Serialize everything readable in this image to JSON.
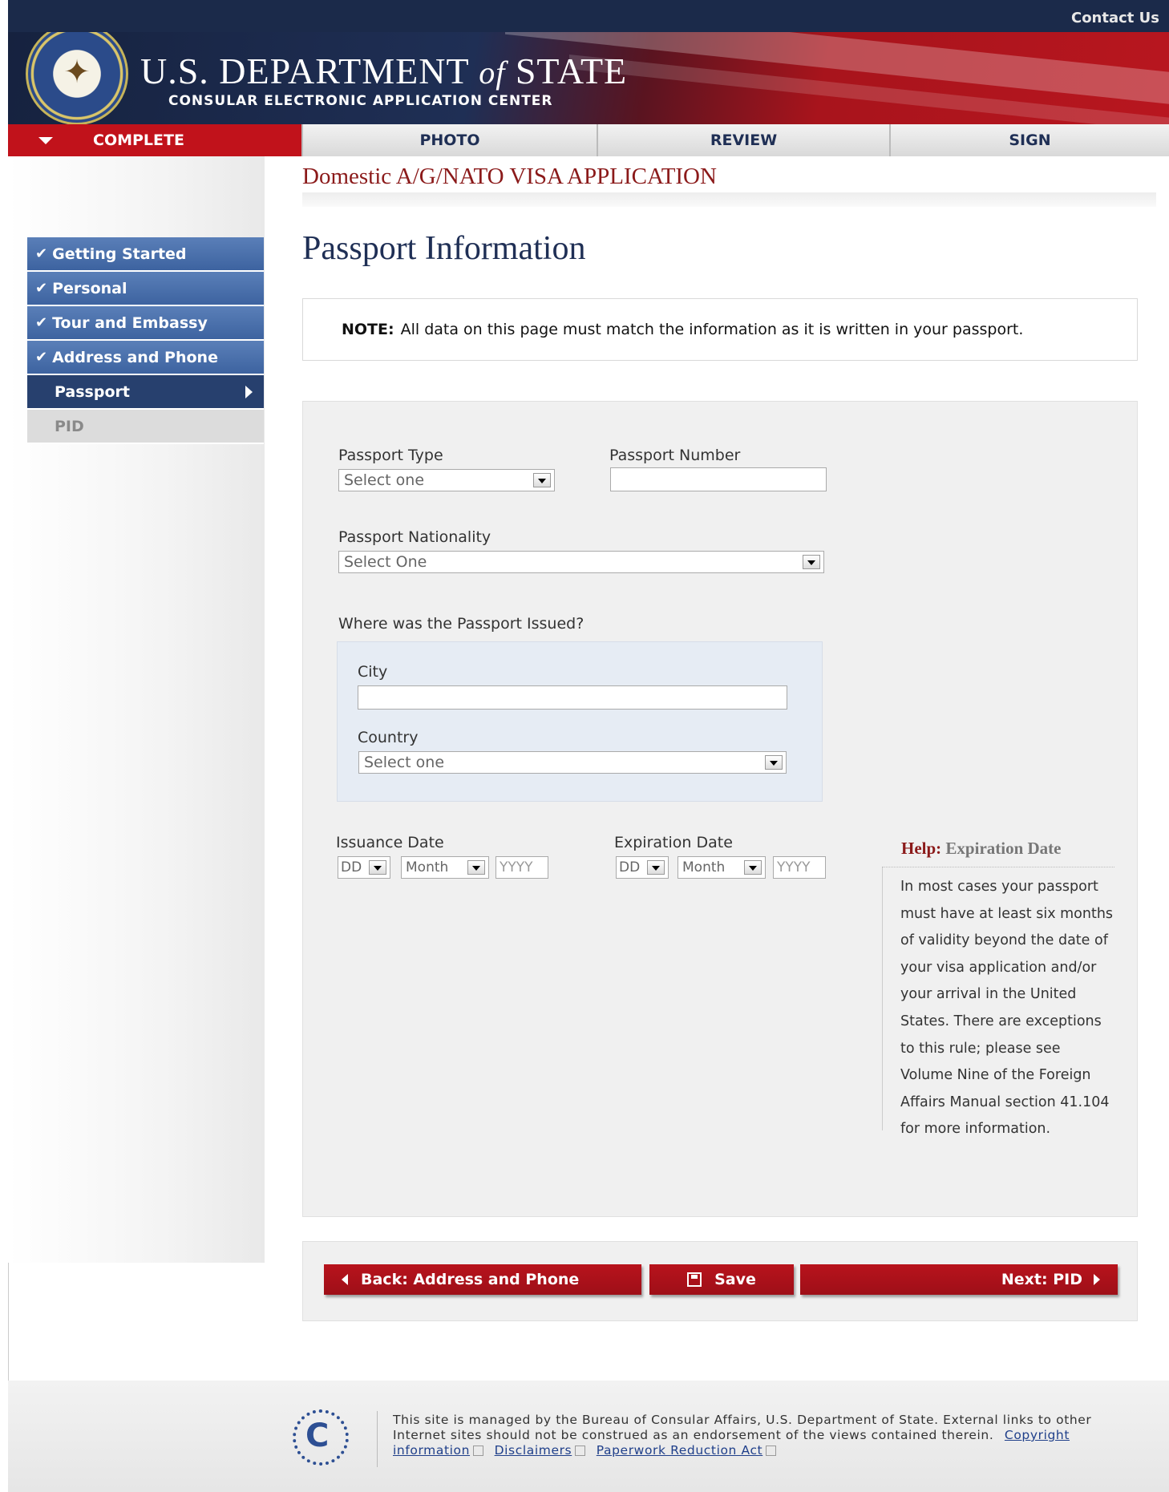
{
  "header": {
    "contact_label": "Contact Us",
    "dept_main": "U.S. DEPARTMENT",
    "dept_of": "of",
    "dept_state": "STATE",
    "subtitle": "CONSULAR ELECTRONIC APPLICATION CENTER"
  },
  "tabs": [
    {
      "label": "COMPLETE",
      "active": true
    },
    {
      "label": "PHOTO",
      "active": false
    },
    {
      "label": "REVIEW",
      "active": false
    },
    {
      "label": "SIGN",
      "active": false
    }
  ],
  "sidebar": {
    "items": [
      {
        "label": "Getting Started",
        "state": "done"
      },
      {
        "label": "Personal",
        "state": "done"
      },
      {
        "label": "Tour and Embassy",
        "state": "done"
      },
      {
        "label": "Address and Phone",
        "state": "done"
      },
      {
        "label": "Passport",
        "state": "current"
      },
      {
        "label": "PID",
        "state": "disabled"
      }
    ]
  },
  "main": {
    "app_title": "Domestic A/G/NATO VISA APPLICATION",
    "page_title": "Passport Information",
    "note_bold": "NOTE:",
    "note_text": "All data on this page must match the information as it is written in your passport."
  },
  "form": {
    "passport_type": {
      "label": "Passport Type",
      "value": "Select one"
    },
    "passport_number": {
      "label": "Passport Number",
      "value": ""
    },
    "passport_nationality": {
      "label": "Passport Nationality",
      "value": "Select One"
    },
    "issued_question": "Where was the Passport Issued?",
    "city": {
      "label": "City",
      "value": ""
    },
    "country": {
      "label": "Country",
      "value": "Select one"
    },
    "issuance_date": {
      "label": "Issuance Date",
      "day": "DD",
      "month": "Month",
      "year_placeholder": "YYYY"
    },
    "expiration_date": {
      "label": "Expiration Date",
      "day": "DD",
      "month": "Month",
      "year_placeholder": "YYYY"
    }
  },
  "help": {
    "prefix": "Help:",
    "title": "Expiration Date",
    "body": "In most cases your passport must have at least six months of validity beyond the date of your visa application and/or your arrival in the United States. There are exceptions to this rule; please see Volume Nine of the Foreign Affairs Manual section 41.104 for more information."
  },
  "buttons": {
    "back": "Back: Address and Phone",
    "save": "Save",
    "next": "Next: PID"
  },
  "footer": {
    "text": "This site is managed by the Bureau of Consular Affairs, U.S. Department of State. External links to other Internet sites should not be construed as an endorsement of the views contained therein.",
    "links": [
      "Copyright information",
      "Disclaimers",
      "Paperwork Reduction Act"
    ],
    "logo_letter": "C"
  },
  "colors": {
    "brand_red": "#c1121b",
    "navy": "#1f2f55",
    "nav_blue": "#4a6fac"
  }
}
